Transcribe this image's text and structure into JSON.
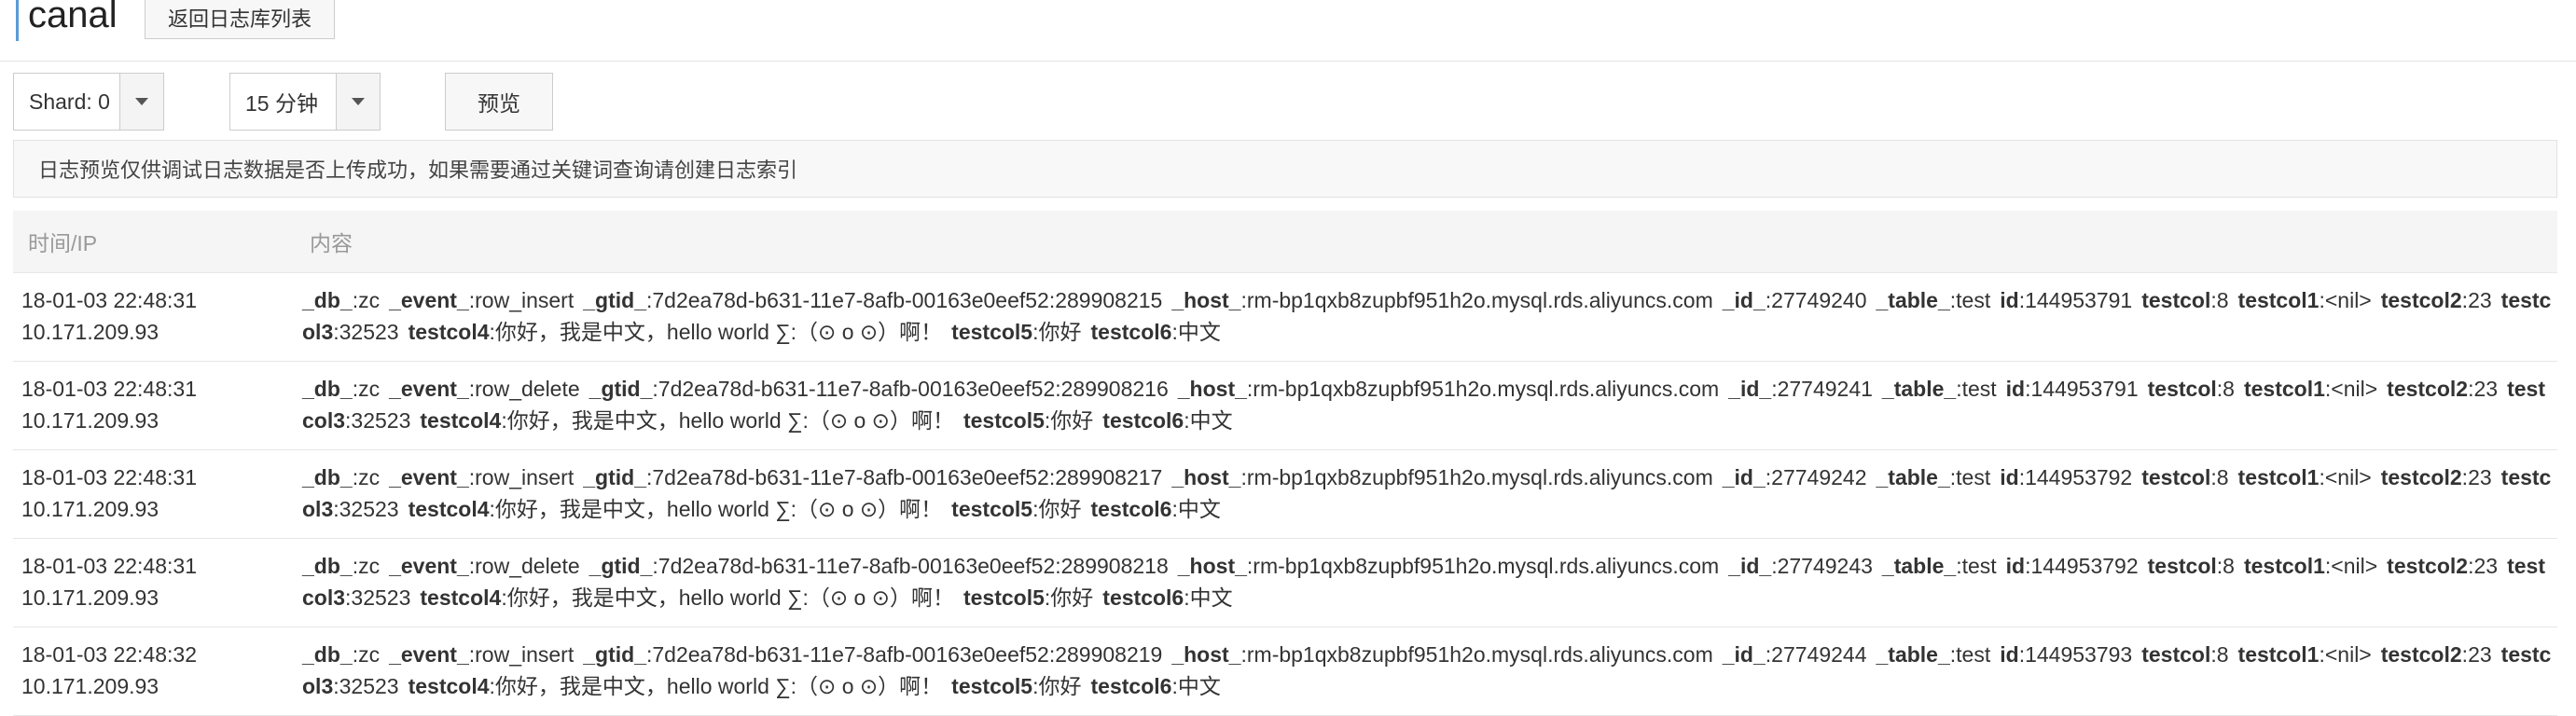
{
  "header": {
    "title": "canal",
    "back_button": "返回日志库列表"
  },
  "controls": {
    "shard_select": "Shard: 0",
    "time_select": "15 分钟",
    "preview_button": "预览"
  },
  "notice": "日志预览仅供调试日志数据是否上传成功，如果需要通过关键词查询请创建日志索引",
  "table": {
    "columns": [
      "时间/IP",
      "内容"
    ],
    "rows": [
      {
        "time": "18-01-03 22:48:31",
        "ip": "10.171.209.93",
        "fields": [
          {
            "k": "_db_",
            "v": "zc"
          },
          {
            "k": "_event_",
            "v": "row_insert"
          },
          {
            "k": "_gtid_",
            "v": "7d2ea78d-b631-11e7-8afb-00163e0eef52:289908215"
          },
          {
            "k": "_host_",
            "v": "rm-bp1qxb8zupbf951h2o.mysql.rds.aliyuncs.com"
          },
          {
            "k": "_id_",
            "v": "27749240"
          },
          {
            "k": "_table_",
            "v": "test"
          },
          {
            "k": "id",
            "v": "144953791"
          },
          {
            "k": "testcol",
            "v": "8"
          },
          {
            "k": "testcol1",
            "v": "<nil>"
          },
          {
            "k": "testcol2",
            "v": "23"
          },
          {
            "k": "testcol3",
            "v": "32523"
          },
          {
            "k": "testcol4",
            "v": "你好，我是中文，hello world ∑:（⊙ o ⊙）啊！"
          },
          {
            "k": "testcol5",
            "v": "你好"
          },
          {
            "k": "testcol6",
            "v": "中文"
          }
        ]
      },
      {
        "time": "18-01-03 22:48:31",
        "ip": "10.171.209.93",
        "fields": [
          {
            "k": "_db_",
            "v": "zc"
          },
          {
            "k": "_event_",
            "v": "row_delete"
          },
          {
            "k": "_gtid_",
            "v": "7d2ea78d-b631-11e7-8afb-00163e0eef52:289908216"
          },
          {
            "k": "_host_",
            "v": "rm-bp1qxb8zupbf951h2o.mysql.rds.aliyuncs.com"
          },
          {
            "k": "_id_",
            "v": "27749241"
          },
          {
            "k": "_table_",
            "v": "test"
          },
          {
            "k": "id",
            "v": "144953791"
          },
          {
            "k": "testcol",
            "v": "8"
          },
          {
            "k": "testcol1",
            "v": "<nil>"
          },
          {
            "k": "testcol2",
            "v": "23"
          },
          {
            "k": "testcol3",
            "v": "32523"
          },
          {
            "k": "testcol4",
            "v": "你好，我是中文，hello world ∑:（⊙ o ⊙）啊！"
          },
          {
            "k": "testcol5",
            "v": "你好"
          },
          {
            "k": "testcol6",
            "v": "中文"
          }
        ]
      },
      {
        "time": "18-01-03 22:48:31",
        "ip": "10.171.209.93",
        "fields": [
          {
            "k": "_db_",
            "v": "zc"
          },
          {
            "k": "_event_",
            "v": "row_insert"
          },
          {
            "k": "_gtid_",
            "v": "7d2ea78d-b631-11e7-8afb-00163e0eef52:289908217"
          },
          {
            "k": "_host_",
            "v": "rm-bp1qxb8zupbf951h2o.mysql.rds.aliyuncs.com"
          },
          {
            "k": "_id_",
            "v": "27749242"
          },
          {
            "k": "_table_",
            "v": "test"
          },
          {
            "k": "id",
            "v": "144953792"
          },
          {
            "k": "testcol",
            "v": "8"
          },
          {
            "k": "testcol1",
            "v": "<nil>"
          },
          {
            "k": "testcol2",
            "v": "23"
          },
          {
            "k": "testcol3",
            "v": "32523"
          },
          {
            "k": "testcol4",
            "v": "你好，我是中文，hello world ∑:（⊙ o ⊙）啊！"
          },
          {
            "k": "testcol5",
            "v": "你好"
          },
          {
            "k": "testcol6",
            "v": "中文"
          }
        ]
      },
      {
        "time": "18-01-03 22:48:31",
        "ip": "10.171.209.93",
        "fields": [
          {
            "k": "_db_",
            "v": "zc"
          },
          {
            "k": "_event_",
            "v": "row_delete"
          },
          {
            "k": "_gtid_",
            "v": "7d2ea78d-b631-11e7-8afb-00163e0eef52:289908218"
          },
          {
            "k": "_host_",
            "v": "rm-bp1qxb8zupbf951h2o.mysql.rds.aliyuncs.com"
          },
          {
            "k": "_id_",
            "v": "27749243"
          },
          {
            "k": "_table_",
            "v": "test"
          },
          {
            "k": "id",
            "v": "144953792"
          },
          {
            "k": "testcol",
            "v": "8"
          },
          {
            "k": "testcol1",
            "v": "<nil>"
          },
          {
            "k": "testcol2",
            "v": "23"
          },
          {
            "k": "testcol3",
            "v": "32523"
          },
          {
            "k": "testcol4",
            "v": "你好，我是中文，hello world ∑:（⊙ o ⊙）啊！"
          },
          {
            "k": "testcol5",
            "v": "你好"
          },
          {
            "k": "testcol6",
            "v": "中文"
          }
        ]
      },
      {
        "time": "18-01-03 22:48:32",
        "ip": "10.171.209.93",
        "fields": [
          {
            "k": "_db_",
            "v": "zc"
          },
          {
            "k": "_event_",
            "v": "row_insert"
          },
          {
            "k": "_gtid_",
            "v": "7d2ea78d-b631-11e7-8afb-00163e0eef52:289908219"
          },
          {
            "k": "_host_",
            "v": "rm-bp1qxb8zupbf951h2o.mysql.rds.aliyuncs.com"
          },
          {
            "k": "_id_",
            "v": "27749244"
          },
          {
            "k": "_table_",
            "v": "test"
          },
          {
            "k": "id",
            "v": "144953793"
          },
          {
            "k": "testcol",
            "v": "8"
          },
          {
            "k": "testcol1",
            "v": "<nil>"
          },
          {
            "k": "testcol2",
            "v": "23"
          },
          {
            "k": "testcol3",
            "v": "32523"
          },
          {
            "k": "testcol4",
            "v": "你好，我是中文，hello world ∑:（⊙ o ⊙）啊！"
          },
          {
            "k": "testcol5",
            "v": "你好"
          },
          {
            "k": "testcol6",
            "v": "中文"
          }
        ]
      }
    ]
  }
}
